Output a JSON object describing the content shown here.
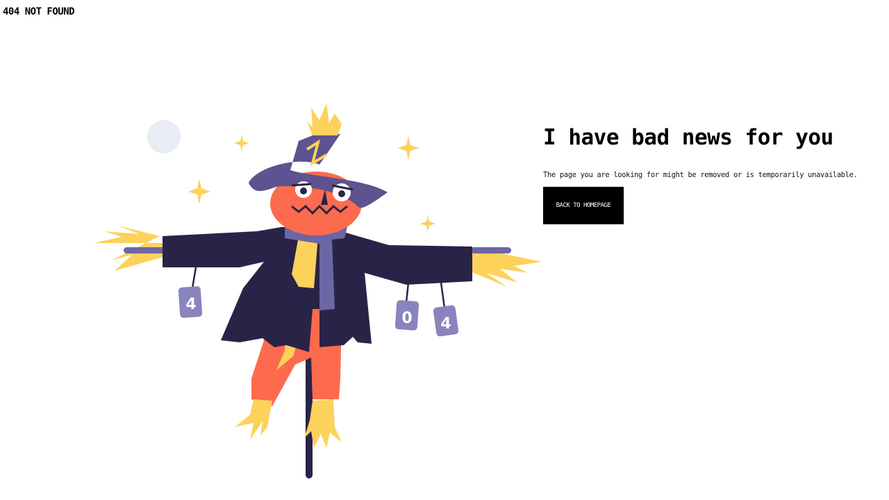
{
  "page": {
    "logo_text": "404 NOT FOUND",
    "headline": "I have bad news for you",
    "message": "The page you are looking for might be removed or is temporarily unavailable.",
    "back_button_label": "BACK TO HOMEPAGE"
  },
  "illustration": {
    "subject": "scarecrow",
    "can_labels": [
      "4",
      "0",
      "4"
    ],
    "colors": {
      "hat": "#5d5390",
      "coat": "#2a2348",
      "pants": "#fd6b4f",
      "straw": "#fcd25b",
      "scarf": "#6d66a4",
      "moon": "#e8ecf4",
      "can": "#8a84bd"
    }
  }
}
